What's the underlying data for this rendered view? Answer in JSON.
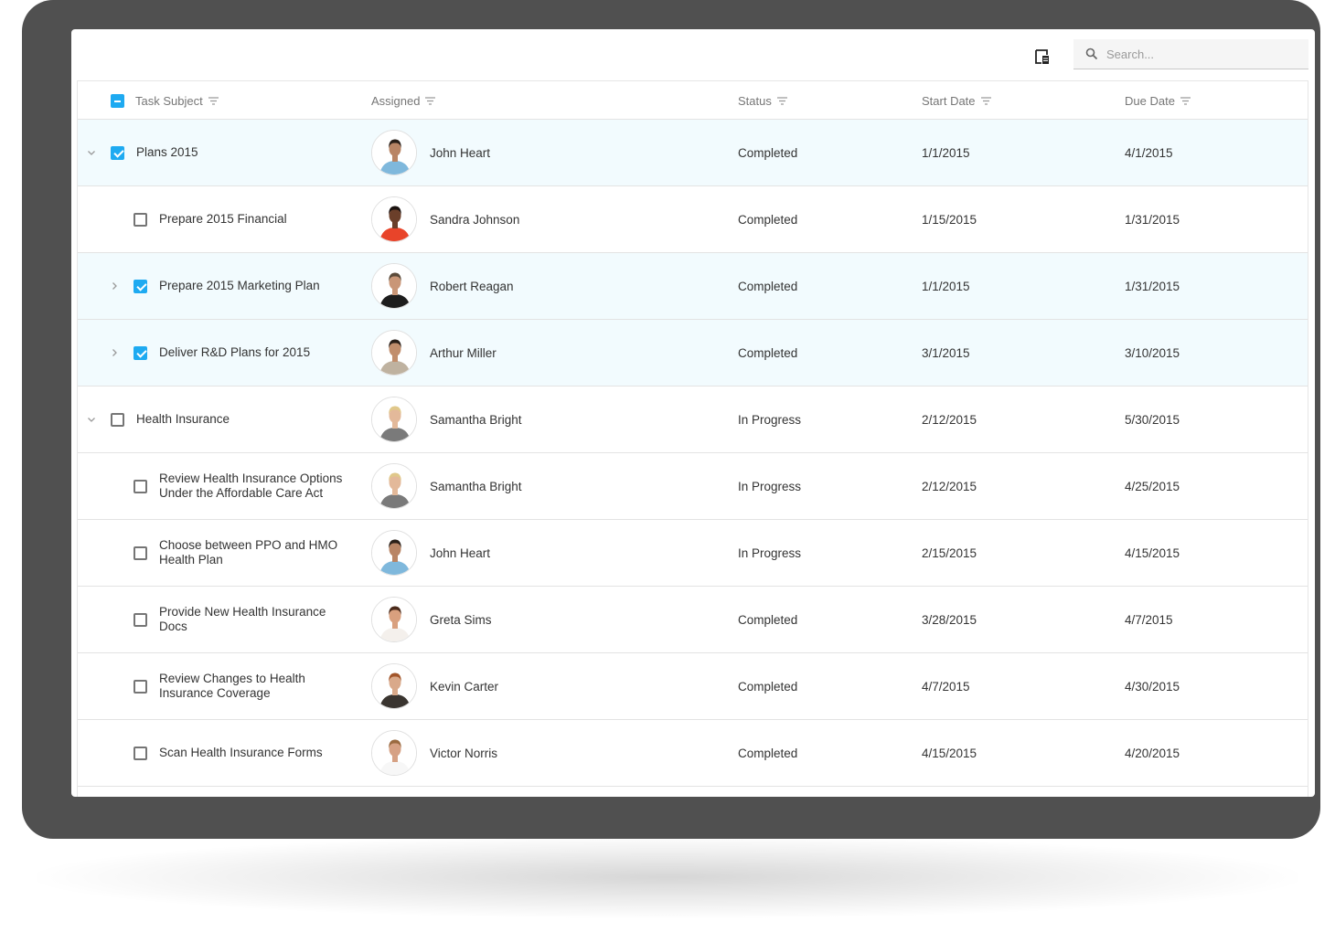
{
  "toolbar": {
    "column_chooser_icon": "column-chooser-icon",
    "search": {
      "placeholder": "Search...",
      "value": "",
      "icon": "search-icon"
    }
  },
  "header": {
    "select_all_state": "indeterminate",
    "columns": [
      {
        "label": "Task Subject",
        "icon": "filter-icon"
      },
      {
        "label": "Assigned",
        "icon": "filter-icon"
      },
      {
        "label": "Status",
        "icon": "filter-icon"
      },
      {
        "label": "Start Date",
        "icon": "filter-icon"
      },
      {
        "label": "Due Date",
        "icon": "filter-icon"
      }
    ]
  },
  "rows": [
    {
      "subject": "Plans 2015",
      "level": 0,
      "expander": "expanded",
      "checked": true,
      "selected": true,
      "assigned": "John Heart",
      "avatar": {
        "shirt": "#7fb8dc",
        "skin": "#b98565",
        "hair": "#2a1f18"
      },
      "status": "Completed",
      "start": "1/1/2015",
      "due": "4/1/2015"
    },
    {
      "subject": "Prepare 2015 Financial",
      "level": 1,
      "expander": "none",
      "checked": false,
      "selected": false,
      "assigned": "Sandra Johnson",
      "avatar": {
        "shirt": "#e8442a",
        "skin": "#6b3f2a",
        "hair": "#1a1210"
      },
      "status": "Completed",
      "start": "1/15/2015",
      "due": "1/31/2015"
    },
    {
      "subject": "Prepare 2015 Marketing Plan",
      "level": 1,
      "expander": "collapsed",
      "checked": true,
      "selected": true,
      "assigned": "Robert Reagan",
      "avatar": {
        "shirt": "#1d1d1d",
        "skin": "#c99677",
        "hair": "#5a4a3a"
      },
      "status": "Completed",
      "start": "1/1/2015",
      "due": "1/31/2015"
    },
    {
      "subject": "Deliver R&D Plans for 2015",
      "level": 1,
      "expander": "collapsed",
      "checked": true,
      "selected": true,
      "assigned": "Arthur Miller",
      "avatar": {
        "shirt": "#bfb2a0",
        "skin": "#c18e6c",
        "hair": "#2a1f18"
      },
      "status": "Completed",
      "start": "3/1/2015",
      "due": "3/10/2015"
    },
    {
      "subject": "Health Insurance",
      "level": 0,
      "expander": "expanded",
      "checked": false,
      "selected": false,
      "assigned": "Samantha Bright",
      "avatar": {
        "shirt": "#7a7a7a",
        "skin": "#e3b99a",
        "hair": "#e0c88a"
      },
      "status": "In Progress",
      "start": "2/12/2015",
      "due": "5/30/2015"
    },
    {
      "subject": "Review Health Insurance Options Under the Affordable Care Act",
      "level": 1,
      "expander": "none",
      "checked": false,
      "selected": false,
      "assigned": "Samantha Bright",
      "avatar": {
        "shirt": "#7a7a7a",
        "skin": "#e3b99a",
        "hair": "#e0c88a"
      },
      "status": "In Progress",
      "start": "2/12/2015",
      "due": "4/25/2015"
    },
    {
      "subject": "Choose between PPO and HMO Health Plan",
      "level": 1,
      "expander": "none",
      "checked": false,
      "selected": false,
      "assigned": "John Heart",
      "avatar": {
        "shirt": "#7fb8dc",
        "skin": "#b98565",
        "hair": "#2a1f18"
      },
      "status": "In Progress",
      "start": "2/15/2015",
      "due": "4/15/2015"
    },
    {
      "subject": "Provide New Health Insurance Docs",
      "level": 1,
      "expander": "none",
      "checked": false,
      "selected": false,
      "assigned": "Greta Sims",
      "avatar": {
        "shirt": "#f4f0ec",
        "skin": "#d9a07e",
        "hair": "#4a2a1a"
      },
      "status": "Completed",
      "start": "3/28/2015",
      "due": "4/7/2015"
    },
    {
      "subject": "Review Changes to Health Insurance Coverage",
      "level": 1,
      "expander": "none",
      "checked": false,
      "selected": false,
      "assigned": "Kevin Carter",
      "avatar": {
        "shirt": "#3a3530",
        "skin": "#d9a98a",
        "hair": "#a2552a"
      },
      "status": "Completed",
      "start": "4/7/2015",
      "due": "4/30/2015"
    },
    {
      "subject": "Scan Health Insurance Forms",
      "level": 1,
      "expander": "none",
      "checked": false,
      "selected": false,
      "assigned": "Victor Norris",
      "avatar": {
        "shirt": "#f7f7f7",
        "skin": "#d6a184",
        "hair": "#9a6a40"
      },
      "status": "Completed",
      "start": "4/15/2015",
      "due": "4/20/2015"
    }
  ],
  "colors": {
    "accent": "#1eaaf1",
    "selected_row": "#f2fbfe",
    "frame": "#505050"
  }
}
